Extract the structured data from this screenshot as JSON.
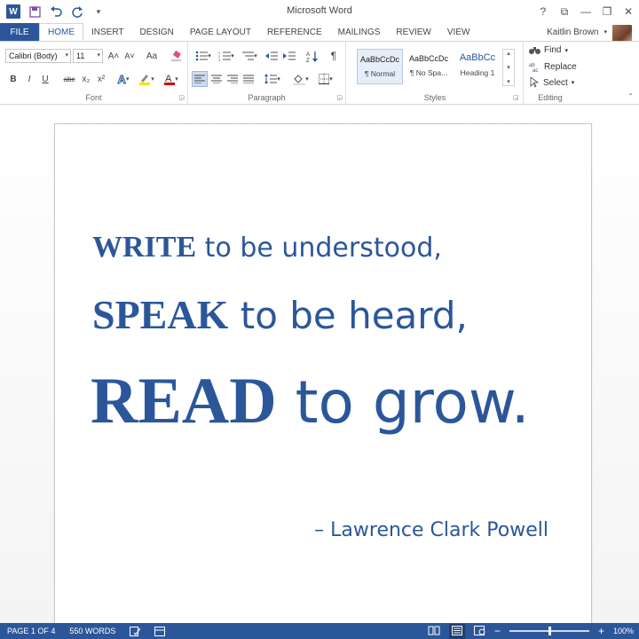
{
  "window": {
    "title": "Microsoft Word"
  },
  "qat": {
    "icons": [
      "word-logo-icon",
      "save-icon",
      "undo-icon",
      "redo-icon",
      "customize-qat-icon"
    ]
  },
  "window_controls": {
    "help": "?",
    "ribbon_display": "⧉",
    "minimize": "—",
    "restore": "❐",
    "close": "✕"
  },
  "tabs": {
    "file": "FILE",
    "items": [
      "HOME",
      "INSERT",
      "DESIGN",
      "PAGE LAYOUT",
      "REFERENCE",
      "MAILINGS",
      "REVIEW",
      "VIEW"
    ],
    "active": "HOME"
  },
  "user": {
    "name": "Kaitlin Brown"
  },
  "ribbon": {
    "font": {
      "label": "Font",
      "font_name": "Calibri (Body)",
      "font_size": "11",
      "grow": "A˄",
      "shrink": "A˅",
      "change_case": "Aa",
      "bold": "B",
      "italic": "I",
      "underline": "U",
      "strikethrough": "abc",
      "subscript": "x₂",
      "superscript": "x²"
    },
    "paragraph": {
      "label": "Paragraph",
      "pilcrow": "¶"
    },
    "styles": {
      "label": "Styles",
      "items": [
        {
          "sample": "AaBbCcDc",
          "name": "¶ Normal"
        },
        {
          "sample": "AaBbCcDc",
          "name": "¶ No Spa..."
        },
        {
          "sample": "AaBbCc",
          "name": "Heading 1"
        }
      ]
    },
    "editing": {
      "label": "Editing",
      "find": "Find",
      "replace": "Replace",
      "select": "Select"
    }
  },
  "document": {
    "line1": {
      "caps": "WRITE",
      "rest": " to be understood,"
    },
    "line2": {
      "caps": "SPEAK",
      "rest": " to be heard,"
    },
    "line3": {
      "caps": "READ",
      "rest": " to grow."
    },
    "author": "– Lawrence Clark Powell"
  },
  "status": {
    "page": "PAGE 1 OF 4",
    "words": "550 WORDS",
    "zoom": "100%",
    "zoom_level": 0.5
  },
  "colors": {
    "accent": "#2b579a",
    "quote_text": "#2b579a"
  }
}
